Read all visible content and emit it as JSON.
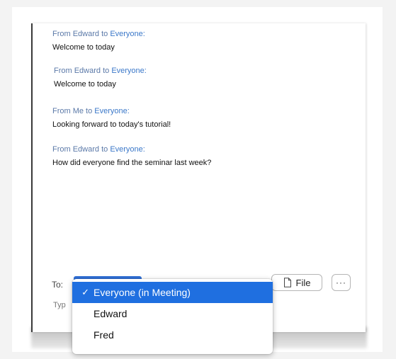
{
  "messages": [
    {
      "from": "From Edward to ",
      "to": "Everyone:",
      "text": "Welcome to today"
    },
    {
      "from": "From Edward to ",
      "to": "Everyone:",
      "text": "Welcome to today"
    },
    {
      "from": "From Me to ",
      "to": "Everyone:",
      "text": "Looking forward to today's tutorial!"
    },
    {
      "from": "From Edward to ",
      "to": "Everyone:",
      "text": "How did everyone find the seminar last week?"
    }
  ],
  "composer": {
    "to_label": "To:",
    "type_hint": "Typ",
    "file_label": "File",
    "more_label": "···"
  },
  "recipient_menu": {
    "selected": "Everyone (in Meeting)",
    "options": [
      "Everyone (in Meeting)",
      "Edward",
      "Fred"
    ],
    "check": "✓"
  },
  "colors": {
    "accent": "#1f6fe0",
    "link": "#3b78c9"
  }
}
